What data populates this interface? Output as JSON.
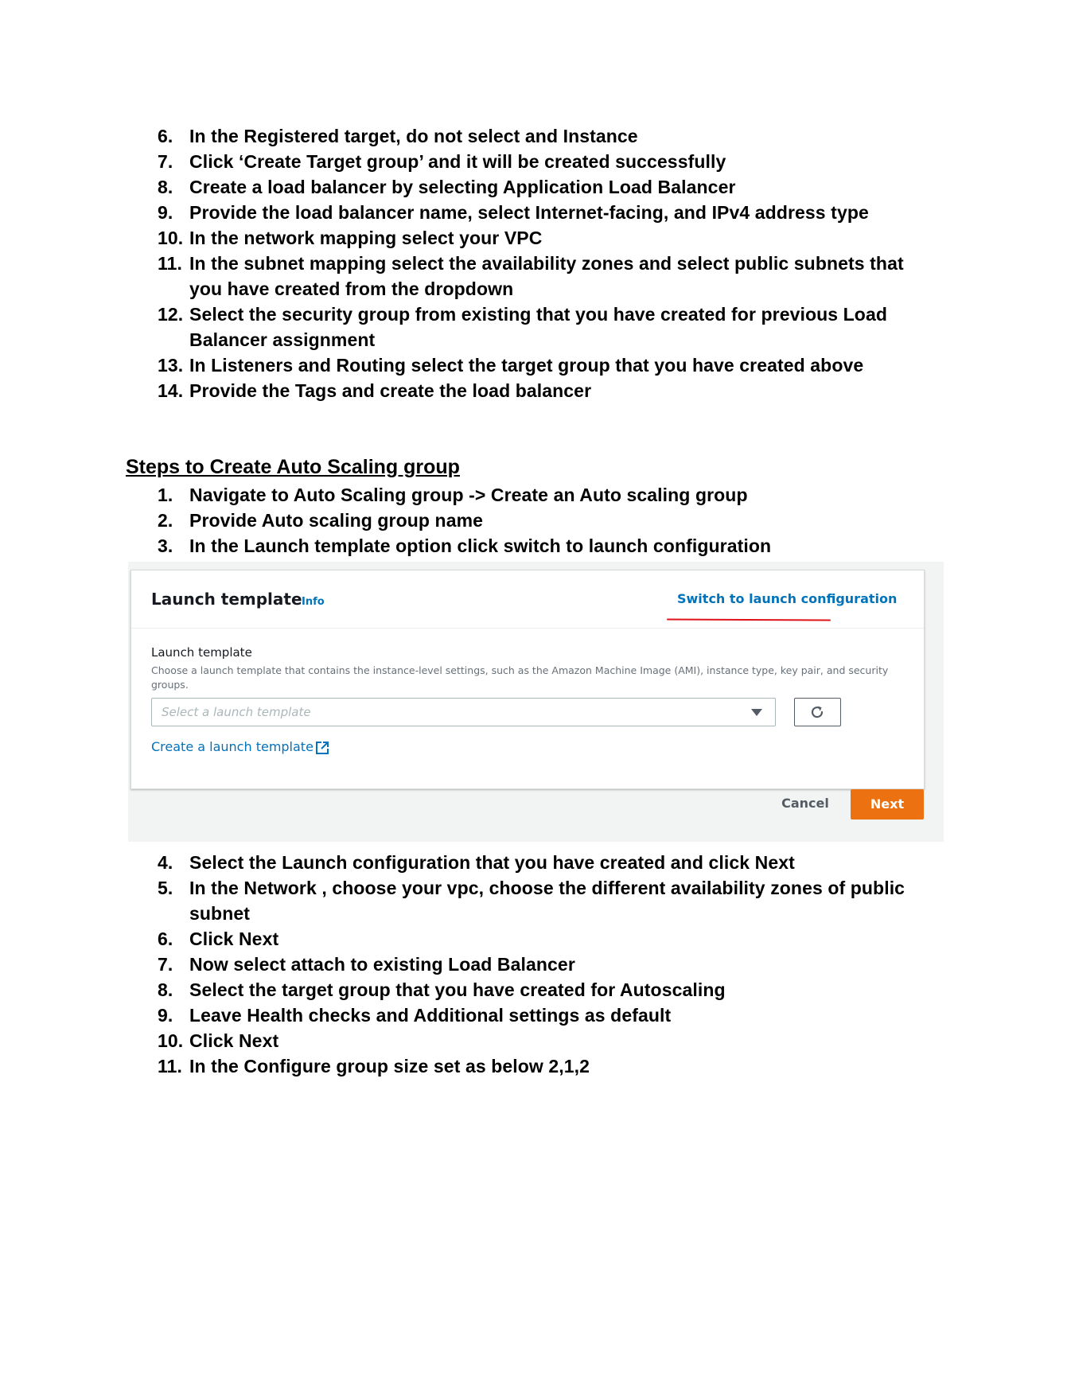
{
  "list_top": [
    {
      "num": "6.",
      "text": "In the Registered target, do not select and Instance"
    },
    {
      "num": "7.",
      "text": "Click ‘Create Target group’ and it will be created successfully"
    },
    {
      "num": "8.",
      "text": "Create a load balancer by selecting Application Load Balancer"
    },
    {
      "num": "9.",
      "text": "Provide the load balancer name, select Internet-facing, and IPv4 address type"
    },
    {
      "num": "10.",
      "text": "In the network mapping select your VPC"
    },
    {
      "num": "11.",
      "text": "In the subnet mapping select the availability zones and select public subnets that you have created from the dropdown"
    },
    {
      "num": "12.",
      "text": "Select the security group from existing that you have created for previous Load Balancer assignment"
    },
    {
      "num": "13.",
      "text": "In Listeners and Routing select the target group that you have created above"
    },
    {
      "num": "14.",
      "text": "Provide the Tags and create the load balancer"
    }
  ],
  "asg_heading": "Steps to Create Auto Scaling group",
  "list_asg": [
    {
      "num": "1.",
      "text": "Navigate to Auto Scaling group -> Create an Auto scaling group"
    },
    {
      "num": "2.",
      "text": "Provide Auto scaling group name"
    },
    {
      "num": "3.",
      "text": "In the Launch template option click switch to launch configuration"
    }
  ],
  "screenshot": {
    "title": "Launch template",
    "info": "Info",
    "switch_link": "Switch to launch configuration",
    "field_label": "Launch template",
    "field_desc": "Choose a launch template that contains the instance-level settings, such as the Amazon Machine Image (AMI), instance type, key pair, and security groups.",
    "select_placeholder": "Select a launch template",
    "create_link": "Create a launch template",
    "cancel": "Cancel",
    "next": "Next",
    "accent": "#ec7211",
    "link_color": "#0073bb",
    "annotation_color": "#e0121a",
    "icons": [
      "caret-down-icon",
      "refresh-icon",
      "external-link-icon"
    ]
  },
  "list_bottom": [
    {
      "num": "4.",
      "text": "Select the Launch configuration that you have created and click Next"
    },
    {
      "num": "5.",
      "text": "In the Network , choose your vpc, choose the different availability zones of public subnet"
    },
    {
      "num": "6.",
      "text": "Click Next"
    },
    {
      "num": "7.",
      "text": "Now select attach to existing Load Balancer"
    },
    {
      "num": "8.",
      "text": "Select the target group that you have created for Autoscaling"
    },
    {
      "num": "9.",
      "text": "Leave Health checks and Additional settings as default"
    },
    {
      "num": "10.",
      "text": "Click Next"
    },
    {
      "num": "11.",
      "text": "In the Configure group size set as below 2,1,2"
    }
  ]
}
